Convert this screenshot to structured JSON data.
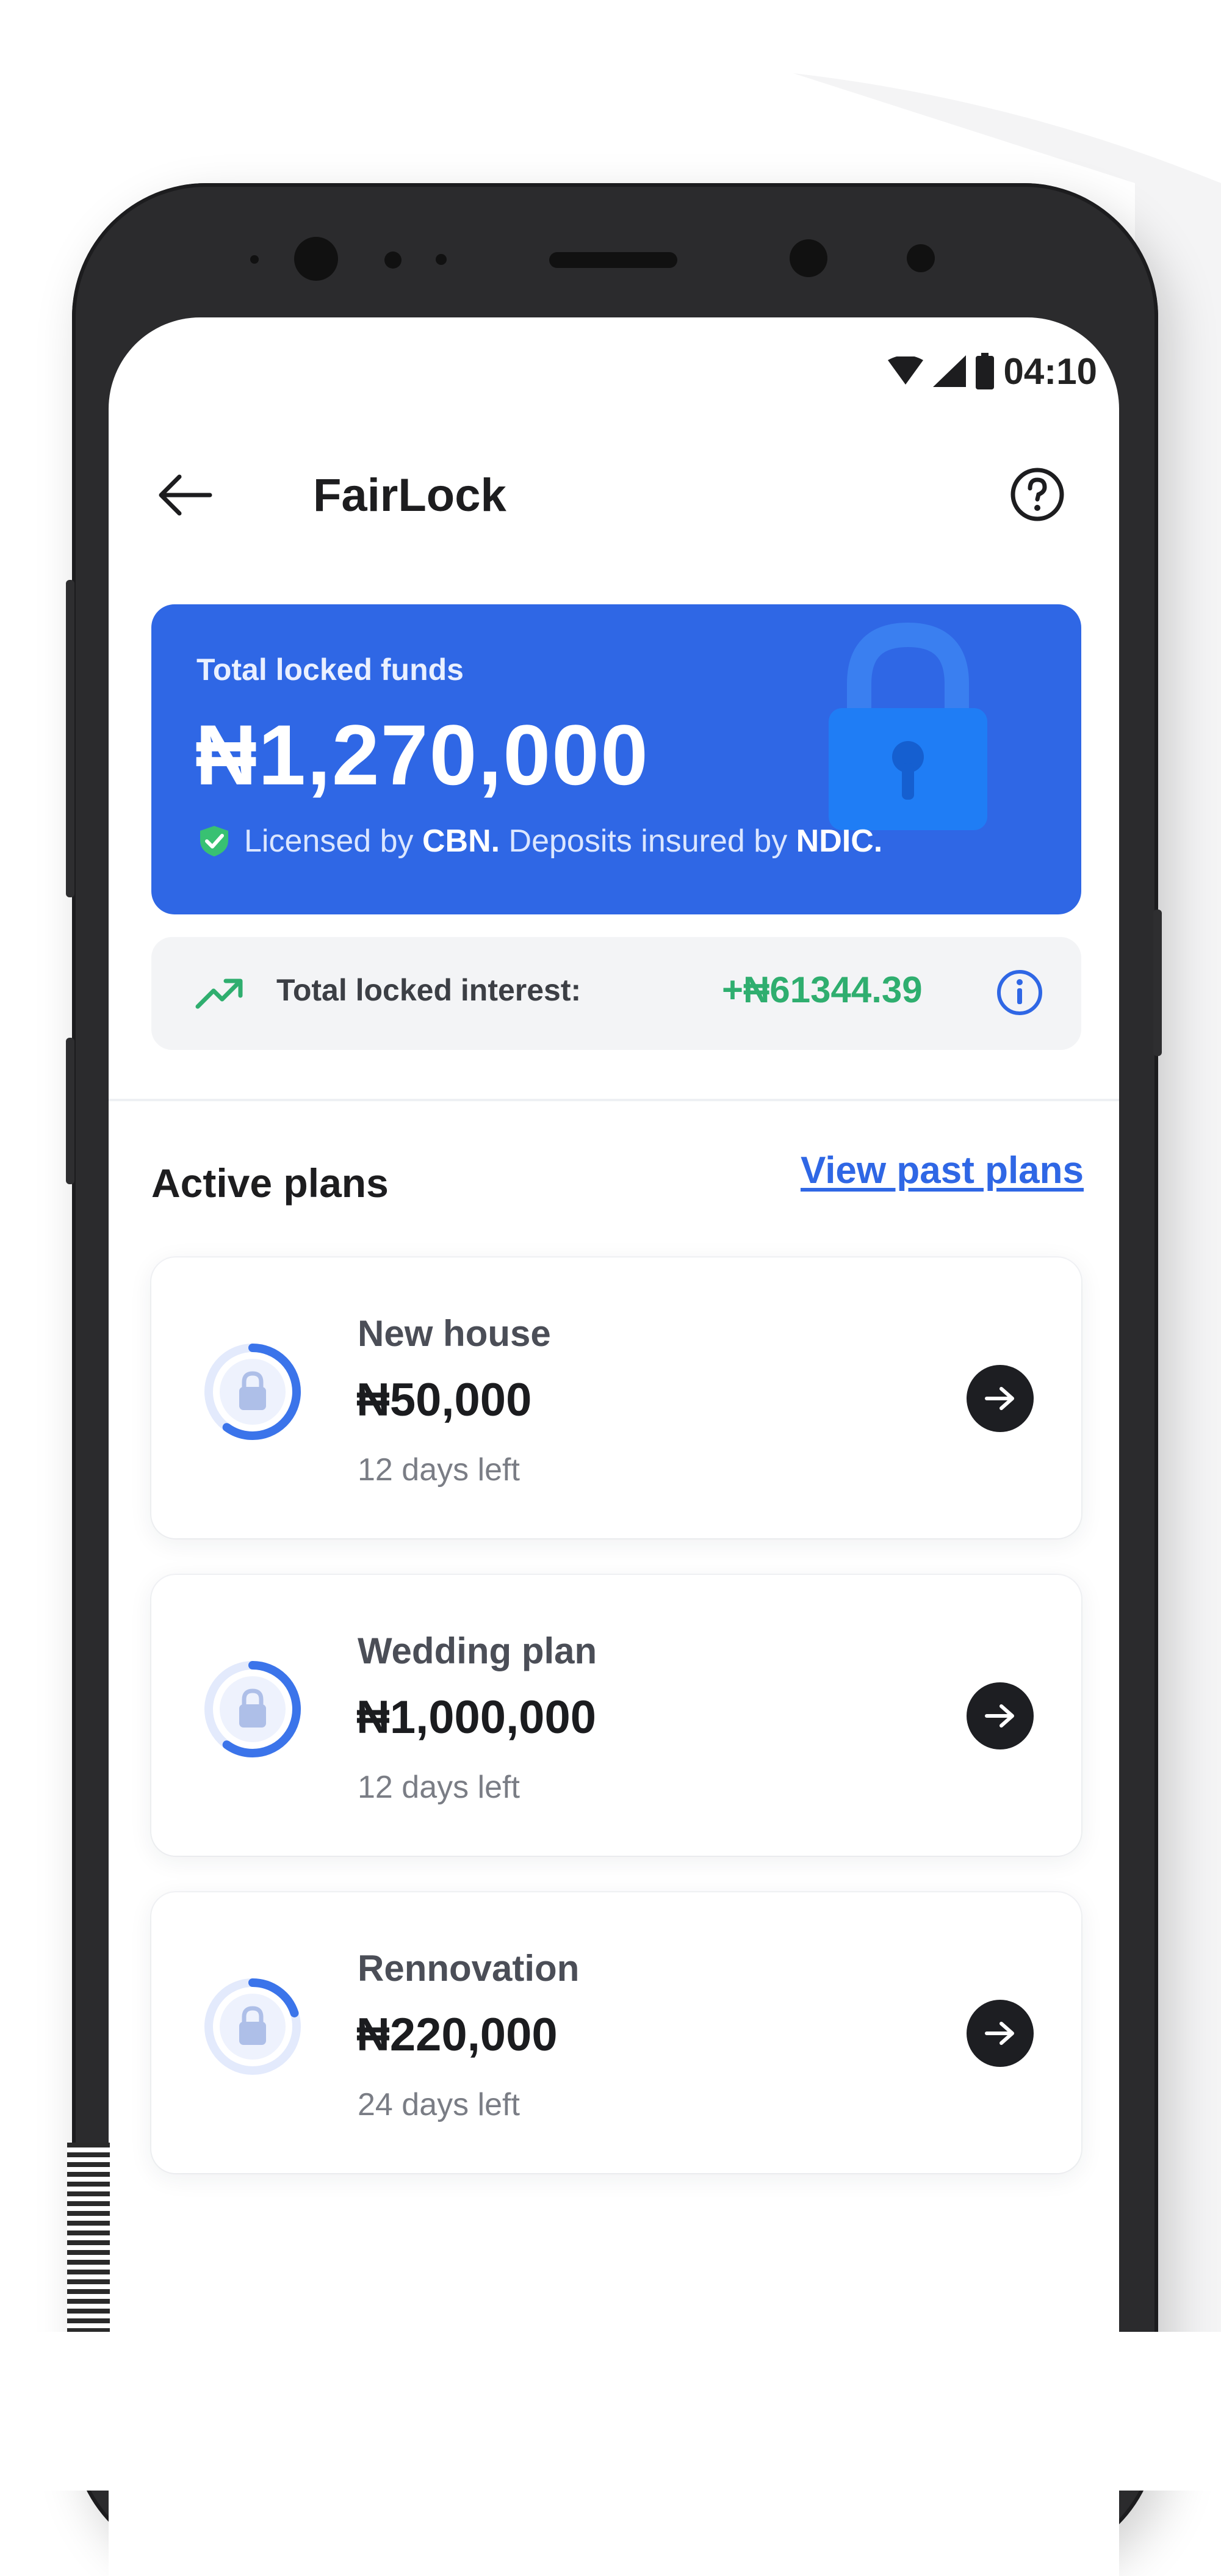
{
  "status_bar": {
    "time": "04:10"
  },
  "header": {
    "title": "FairLock"
  },
  "balance_card": {
    "label": "Total locked funds",
    "amount": "₦1,270,000",
    "license_prefix": "Licensed by ",
    "license_regulator": "CBN.",
    "license_middle": " Deposits insured by ",
    "license_insurer": "NDIC."
  },
  "interest": {
    "label": "Total locked interest:",
    "value": "+₦61344.39"
  },
  "plans_section": {
    "title": "Active plans",
    "past_link": "View past plans"
  },
  "plans": [
    {
      "name": "New house",
      "amount": "₦50,000",
      "days_left": "12 days left",
      "progress": 0.6
    },
    {
      "name": "Wedding plan",
      "amount": "₦1,000,000",
      "days_left": "12 days left",
      "progress": 0.6
    },
    {
      "name": "Rennovation",
      "amount": "₦220,000",
      "days_left": "24 days left",
      "progress": 0.2
    }
  ],
  "colors": {
    "primary": "#2f67e5",
    "positive": "#2fae6f",
    "dark": "#1d1e22"
  }
}
